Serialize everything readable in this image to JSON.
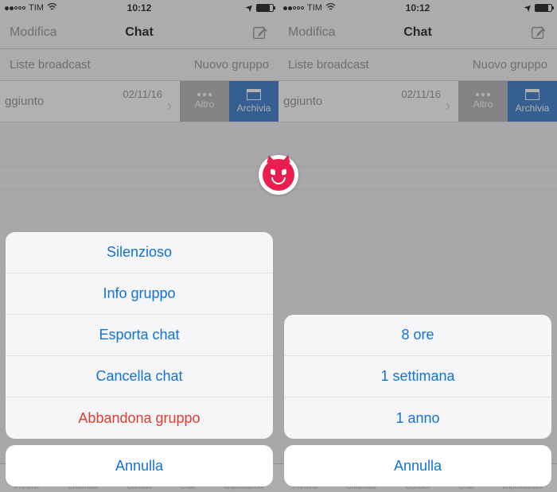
{
  "statusbar": {
    "carrier": "TIM",
    "time": "10:12"
  },
  "navbar": {
    "edit": "Modifica",
    "title": "Chat"
  },
  "subbar": {
    "left": "Liste broadcast",
    "right": "Nuovo gruppo"
  },
  "chatrow": {
    "snippet": "ggiunto",
    "date": "02/11/16",
    "altro_label": "Altro",
    "archivia_label": "Archivia"
  },
  "tabbar": {
    "items": [
      "Preferiti",
      "Chiamate",
      "Contatti",
      "Chat",
      "Impostazioni"
    ]
  },
  "sheet_left": {
    "items": [
      {
        "label": "Silenzioso",
        "destructive": false
      },
      {
        "label": "Info gruppo",
        "destructive": false
      },
      {
        "label": "Esporta chat",
        "destructive": false
      },
      {
        "label": "Cancella chat",
        "destructive": false
      },
      {
        "label": "Abbandona gruppo",
        "destructive": true
      }
    ],
    "cancel": "Annulla"
  },
  "sheet_right": {
    "items": [
      {
        "label": "8 ore",
        "destructive": false
      },
      {
        "label": "1 settimana",
        "destructive": false
      },
      {
        "label": "1 anno",
        "destructive": false
      }
    ],
    "cancel": "Annulla"
  }
}
